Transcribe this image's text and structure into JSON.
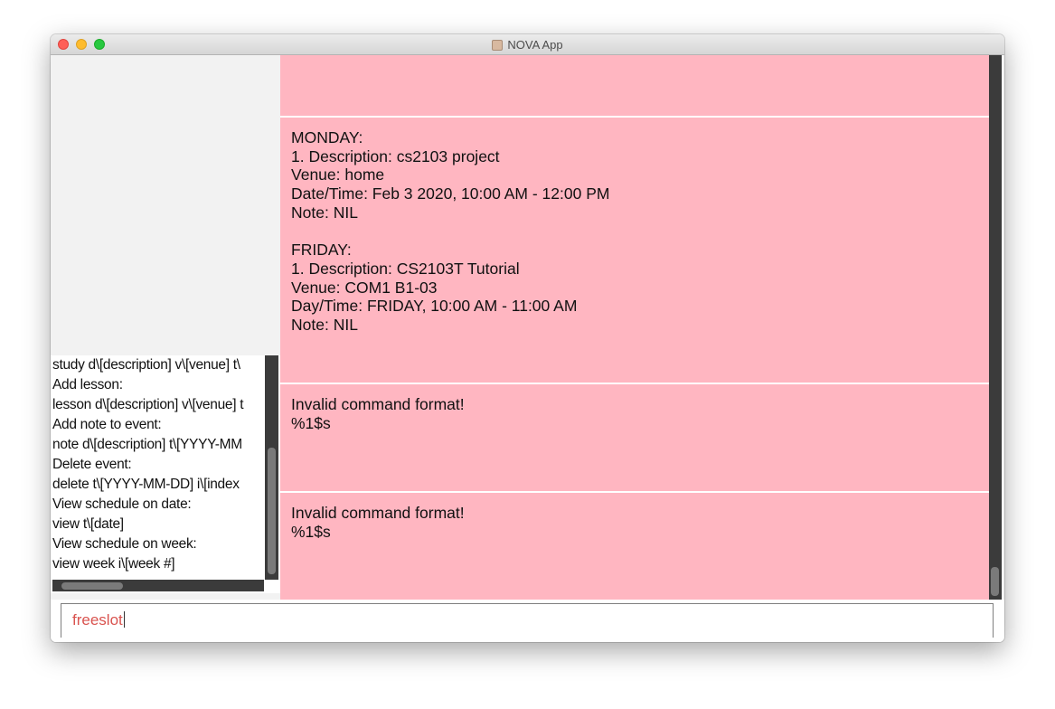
{
  "window": {
    "title": "NOVA App"
  },
  "help_panel": {
    "lines": [
      "study d\\[description] v\\[venue] t\\",
      "Add lesson:",
      "lesson d\\[description] v\\[venue] t",
      "Add note to event:",
      "note d\\[description] t\\[YYYY-MM",
      "Delete event:",
      "delete t\\[YYYY-MM-DD] i\\[index",
      "View schedule on date:",
      "view t\\[date]",
      "View schedule on week:",
      "view week i\\[week #]"
    ]
  },
  "result_list": {
    "cards": [
      {
        "lines": []
      },
      {
        "lines": [
          "MONDAY:",
          "1. Description: cs2103 project",
          "Venue: home",
          "Date/Time: Feb 3 2020, 10:00 AM - 12:00 PM",
          "Note: NIL",
          "",
          "FRIDAY:",
          "1. Description: CS2103T Tutorial",
          "Venue: COM1 B1-03",
          "Day/Time: FRIDAY, 10:00 AM - 11:00 AM",
          "Note: NIL"
        ]
      },
      {
        "lines": [
          "Invalid command format!",
          "%1$s"
        ]
      },
      {
        "lines": [
          "Invalid command format!",
          "%1$s"
        ]
      }
    ]
  },
  "command_box": {
    "value": "freeslot",
    "text_color": "#d9534f"
  },
  "colors": {
    "card_background": "#ffb6c1",
    "scrollbar_track": "#3b3b3b",
    "scrollbar_thumb": "#7a7a7a"
  }
}
